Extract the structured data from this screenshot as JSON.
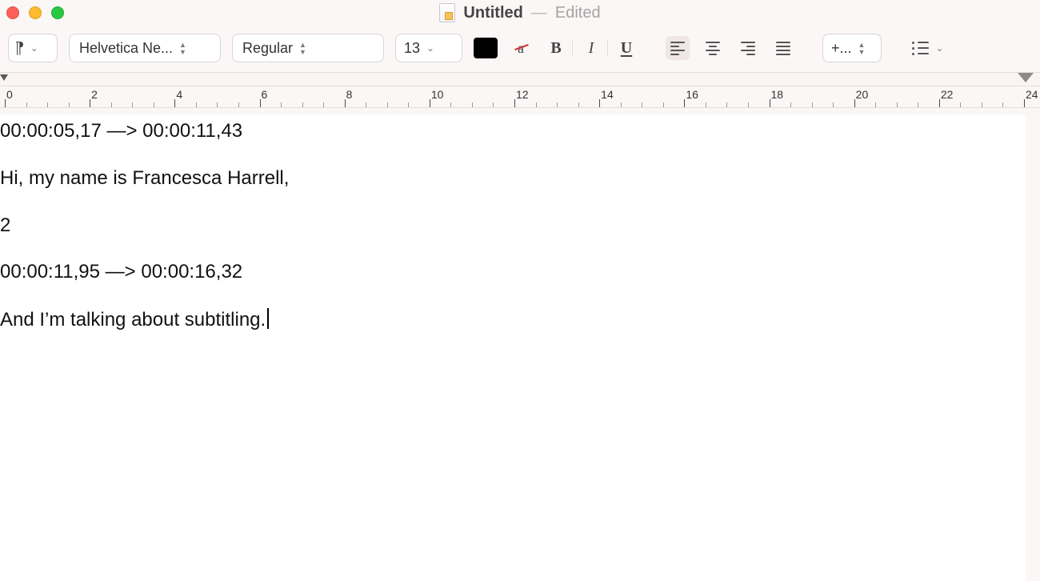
{
  "window": {
    "title": "Untitled",
    "status": "Edited",
    "separator": "—"
  },
  "toolbar": {
    "paragraph_style_icon": "¶",
    "font_family": "Helvetica Ne...",
    "font_style": "Regular",
    "font_size": "13",
    "text_color": "#000000",
    "line_spacing_label": "+..."
  },
  "ruler": {
    "major_ticks": [
      "0",
      "2",
      "4",
      "6",
      "8",
      "10",
      "12",
      "14",
      "16",
      "18",
      "20",
      "22",
      "24"
    ]
  },
  "document": {
    "lines": [
      "00:00:05,17  —>  00:00:11,43",
      "Hi, my name is Francesca Harrell,",
      "2",
      "00:00:11,95  —>  00:00:16,32",
      "And I’m talking about subtitling."
    ]
  }
}
